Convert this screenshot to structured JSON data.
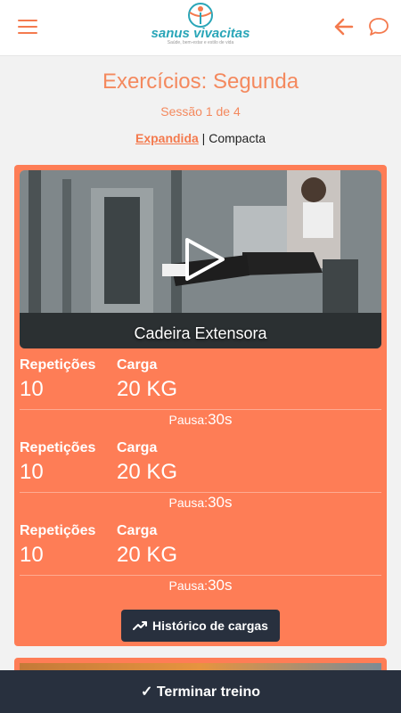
{
  "header": {
    "menu_icon": "hamburger-menu-icon",
    "logo_name": "sanus vivacitas",
    "logo_tagline": "Saúde, bem-estar e estilo de vida",
    "back_icon": "arrow-left-icon",
    "chat_icon": "chat-bubble-icon",
    "accent_color": "#f47a4e"
  },
  "page": {
    "title": "Exercícios: Segunda",
    "session": "Sessão 1 de 4",
    "view_expanded": "Expandida",
    "separator": " | ",
    "view_compact": "Compacta"
  },
  "exercise": {
    "name": "Cadeira Extensora",
    "play_icon": "play-icon",
    "card_color": "#fe7d56",
    "sets": [
      {
        "rep_label": "Repetições",
        "reps": "10",
        "load_label": "Carga",
        "load": "20 KG",
        "pause_label": "Pausa:",
        "pause": "30s"
      },
      {
        "rep_label": "Repetições",
        "reps": "10",
        "load_label": "Carga",
        "load": "20 KG",
        "pause_label": "Pausa:",
        "pause": "30s"
      },
      {
        "rep_label": "Repetições",
        "reps": "10",
        "load_label": "Carga",
        "load": "20 KG",
        "pause_label": "Pausa:",
        "pause": "30s"
      }
    ],
    "history_button": "Histórico de cargas",
    "history_icon": "trending-up-icon"
  },
  "footer": {
    "finish_button": "✓ Terminar treino"
  }
}
